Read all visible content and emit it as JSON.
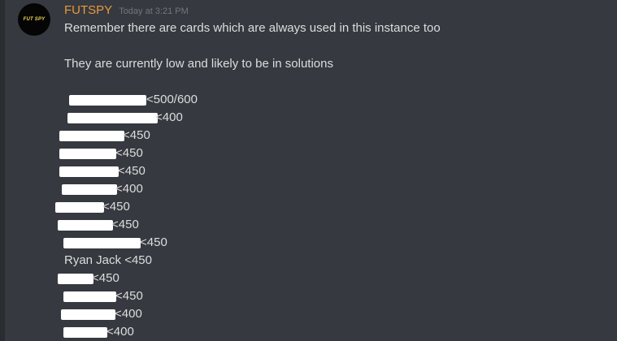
{
  "message": {
    "avatar_text": "FUT SPY",
    "username": "FUTSPY",
    "timestamp": "Today at 3:21 PM",
    "lines": [
      "Remember there are cards which are always used in this instance too",
      "They are currently low and likely to be in solutions"
    ],
    "cards": [
      {
        "text": "<500/600",
        "redacted": true
      },
      {
        "text": "<400",
        "redacted": true
      },
      {
        "text": "<450",
        "redacted": true
      },
      {
        "text": "<450",
        "redacted": true
      },
      {
        "text": "<450",
        "redacted": true
      },
      {
        "text": "<400",
        "redacted": true
      },
      {
        "text": "<450",
        "redacted": true
      },
      {
        "text": "<450",
        "redacted": true
      },
      {
        "text": "<450",
        "redacted": true
      },
      {
        "text": "Ryan Jack <450",
        "redacted": false
      },
      {
        "text": "<450",
        "redacted": true
      },
      {
        "text": "<450",
        "redacted": true
      },
      {
        "text": "<400",
        "redacted": true
      },
      {
        "text": "<400",
        "redacted": true
      }
    ]
  },
  "colors": {
    "background": "#36393f",
    "username": "#e79a3c",
    "text": "#dcddde",
    "timestamp": "#72767d",
    "redaction": "#ffffff"
  }
}
